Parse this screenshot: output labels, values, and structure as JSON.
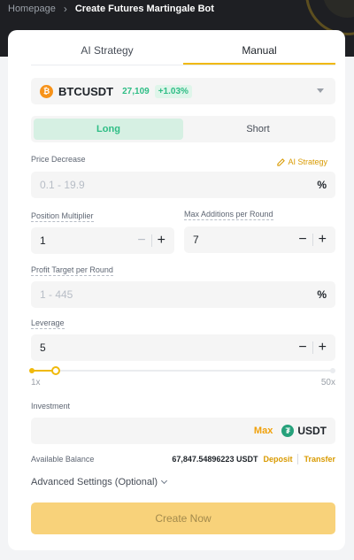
{
  "breadcrumb": {
    "home": "Homepage",
    "separator": "›",
    "current": "Create Futures Martingale Bot"
  },
  "tabs": [
    {
      "label": "AI Strategy",
      "active": false
    },
    {
      "label": "Manual",
      "active": true
    }
  ],
  "pair": {
    "coin_glyph": "₿",
    "name": "BTCUSDT",
    "price": "27,109",
    "change": "+1.03%",
    "coin_color": "#f7931a"
  },
  "side": {
    "long": "Long",
    "short": "Short",
    "selected": "Long"
  },
  "price_decrease": {
    "label": "Price Decrease",
    "placeholder": "0.1 - 19.9",
    "unit": "%",
    "ai_link": "AI Strategy"
  },
  "position_multiplier": {
    "label": "Position Multiplier",
    "value": "1"
  },
  "max_additions": {
    "label": "Max Additions per Round",
    "value": "7"
  },
  "profit_target": {
    "label": "Profit Target per Round",
    "placeholder": "1 - 445",
    "unit": "%"
  },
  "leverage": {
    "label": "Leverage",
    "value": "5",
    "min_label": "1x",
    "max_label": "50x",
    "level": 5,
    "min": 1,
    "max": 50
  },
  "investment": {
    "label": "Investment",
    "max_label": "Max",
    "currency": "USDT",
    "currency_glyph": "₮"
  },
  "balance": {
    "label": "Available Balance",
    "value": "67,847.54896223 USDT",
    "deposit": "Deposit",
    "transfer": "Transfer"
  },
  "advanced": {
    "label": "Advanced Settings (Optional)"
  },
  "submit": {
    "label": "Create Now"
  },
  "stepper": {
    "minus": "−",
    "plus": "+"
  },
  "colors": {
    "accent": "#f0b90b",
    "positive": "#2ebd85",
    "link": "#d99a00"
  }
}
